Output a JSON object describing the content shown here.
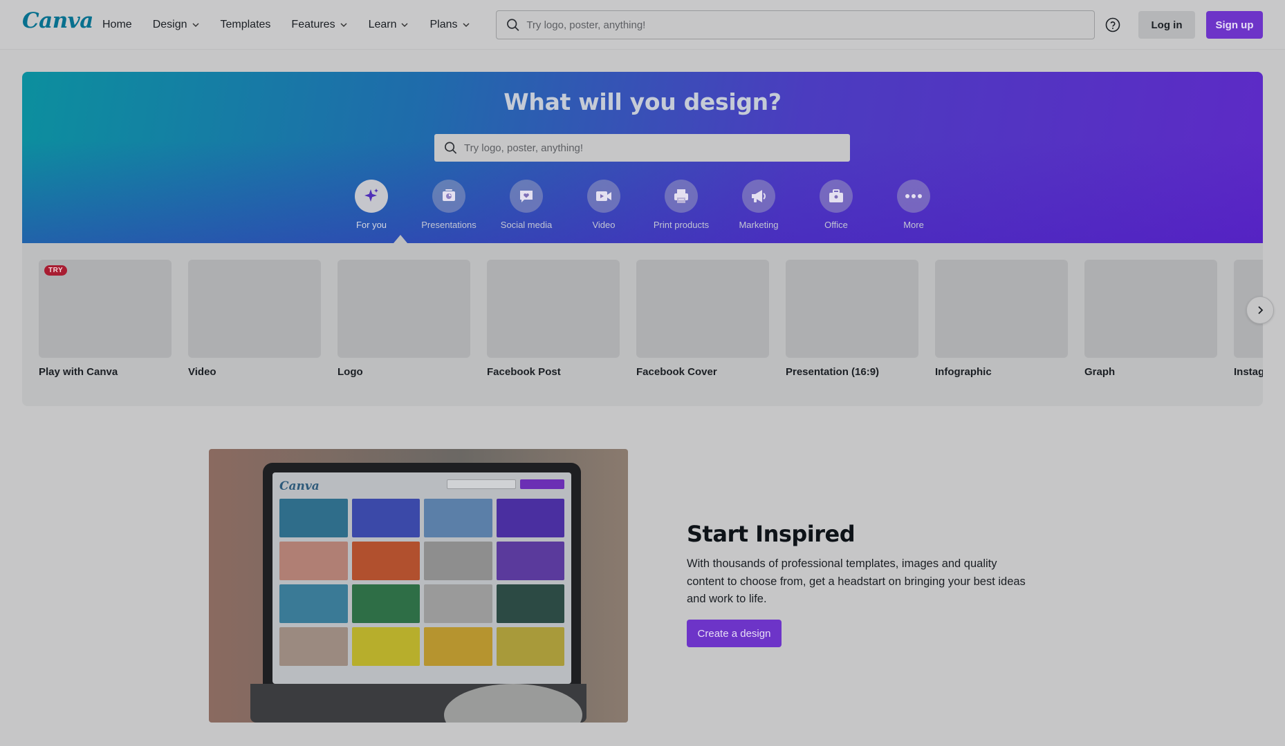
{
  "header": {
    "logo": "Canva",
    "nav": [
      {
        "label": "Home",
        "has_dropdown": false
      },
      {
        "label": "Design",
        "has_dropdown": true
      },
      {
        "label": "Templates",
        "has_dropdown": false
      },
      {
        "label": "Features",
        "has_dropdown": true
      },
      {
        "label": "Learn",
        "has_dropdown": true
      },
      {
        "label": "Plans",
        "has_dropdown": true
      }
    ],
    "search_placeholder": "Try logo, poster, anything!",
    "login_label": "Log in",
    "signup_label": "Sign up"
  },
  "hero": {
    "title": "What will you design?",
    "search_placeholder": "Try logo, poster, anything!",
    "categories": [
      {
        "label": "For you",
        "icon": "sparkle-icon",
        "active": true
      },
      {
        "label": "Presentations",
        "icon": "presentation-icon",
        "active": false
      },
      {
        "label": "Social media",
        "icon": "heart-speech-icon",
        "active": false
      },
      {
        "label": "Video",
        "icon": "video-camera-icon",
        "active": false
      },
      {
        "label": "Print products",
        "icon": "printer-icon",
        "active": false
      },
      {
        "label": "Marketing",
        "icon": "megaphone-icon",
        "active": false
      },
      {
        "label": "Office",
        "icon": "briefcase-icon",
        "active": false
      },
      {
        "label": "More",
        "icon": "more-dots-icon",
        "active": false
      }
    ]
  },
  "design_types": {
    "try_badge": "TRY",
    "items": [
      {
        "label": "Play with Canva"
      },
      {
        "label": "Video"
      },
      {
        "label": "Logo"
      },
      {
        "label": "Facebook Post"
      },
      {
        "label": "Facebook Cover"
      },
      {
        "label": "Presentation (16:9)"
      },
      {
        "label": "Infographic"
      },
      {
        "label": "Graph"
      },
      {
        "label": "Instag"
      }
    ]
  },
  "promo": {
    "screen_logo": "Canva",
    "title": "Start Inspired",
    "text": "With thousands of professional templates, images and quality content to choose from, get a headstart on bringing your best ideas and work to life.",
    "cta_label": "Create a design"
  },
  "colors": {
    "brand_purple": "#6d34c8",
    "logo_teal": "#08708e",
    "badge_red": "#a81d32"
  }
}
